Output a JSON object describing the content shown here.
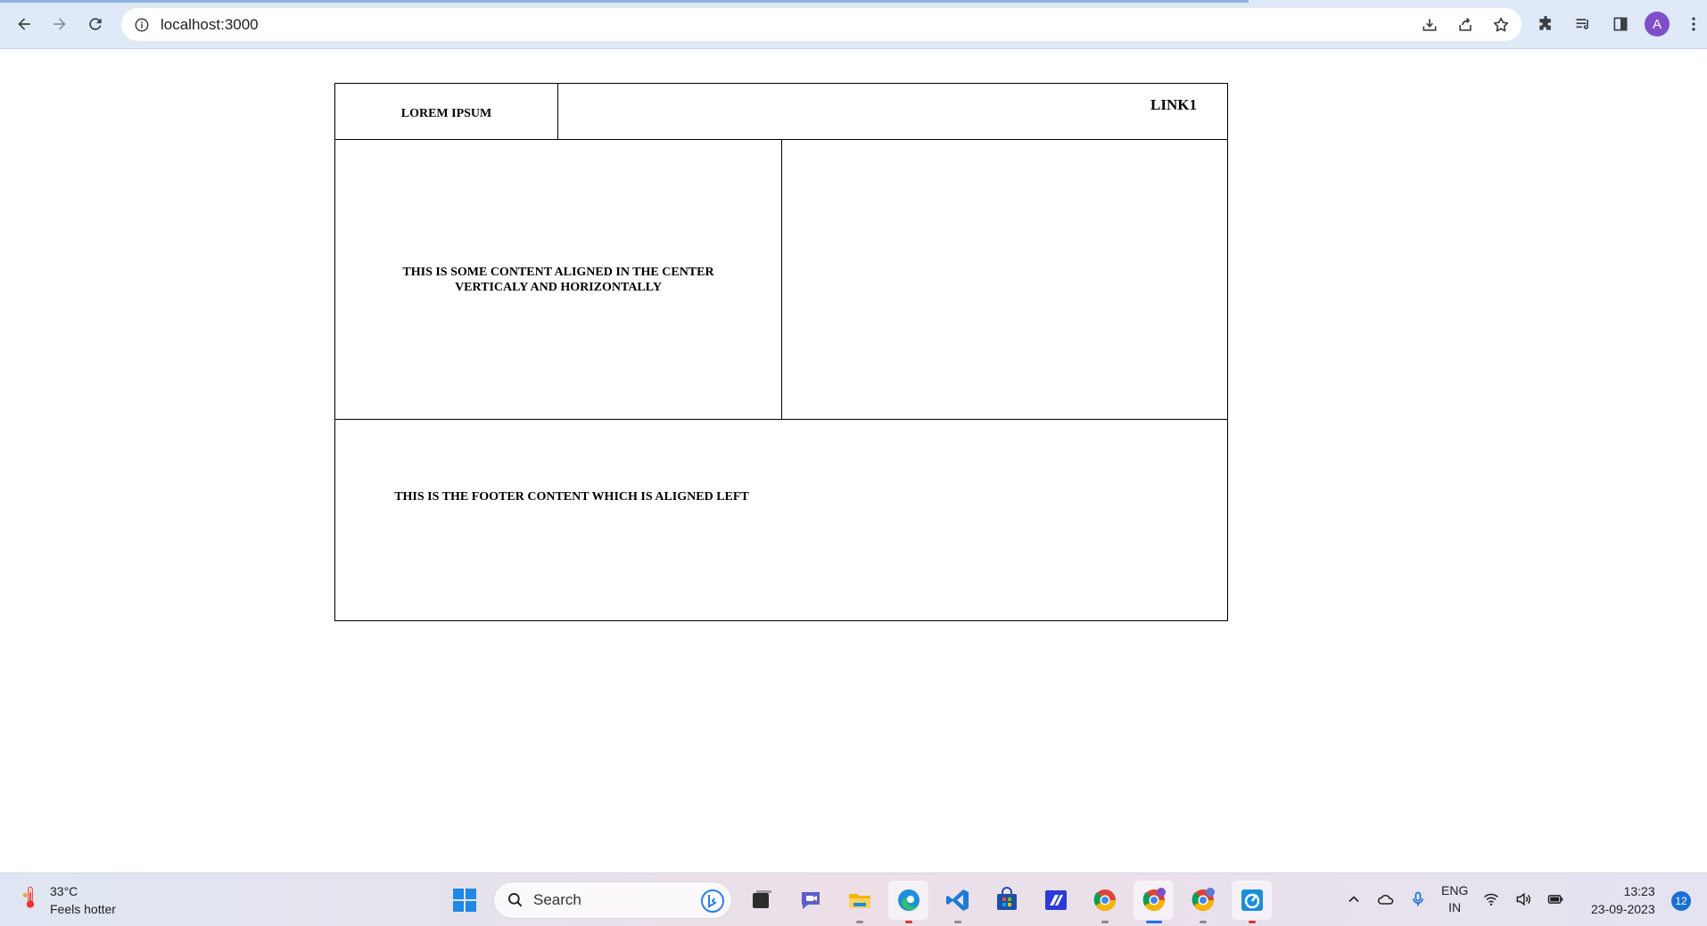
{
  "browser": {
    "url": "localhost:3000",
    "avatar_letter": "A"
  },
  "page": {
    "header": {
      "logo_text": "LOREM IPSUM",
      "link_text": "LINK1"
    },
    "main": {
      "center_text": "THIS IS SOME CONTENT ALIGNED IN THE CENTER VERTICALY AND HORIZONTALLY"
    },
    "footer": {
      "text": "THIS IS THE FOOTER CONTENT WHICH IS ALIGNED LEFT"
    }
  },
  "taskbar": {
    "weather": {
      "temperature": "33°C",
      "description": "Feels hotter"
    },
    "search_label": "Search",
    "language": {
      "line1": "ENG",
      "line2": "IN"
    },
    "clock": {
      "time": "13:23",
      "date": "23-09-2023"
    },
    "notification_count": "12"
  },
  "colors": {
    "chrome_bg": "#dfe9f8",
    "avatar": "#7f4fc9",
    "accent": "#1a73e8"
  }
}
